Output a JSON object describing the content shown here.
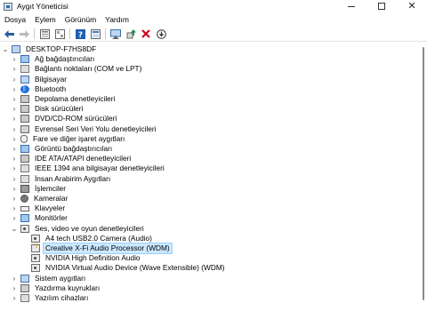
{
  "window": {
    "title": "Aygıt Yöneticisi",
    "buttons": {
      "minimize": "—",
      "maximize": "□",
      "close": "✕"
    }
  },
  "menu": [
    "Dosya",
    "Eylem",
    "Görünüm",
    "Yardım"
  ],
  "toolbar": {
    "items": [
      {
        "name": "back-icon",
        "glyph": "←"
      },
      {
        "name": "forward-icon",
        "glyph": "→"
      },
      {
        "name": "properties-icon",
        "glyph": "▦"
      },
      {
        "name": "show-hidden-icon",
        "glyph": "▤"
      },
      {
        "name": "help-icon",
        "glyph": "?"
      },
      {
        "name": "view-icon",
        "glyph": "▦"
      },
      {
        "name": "scan-hardware-icon",
        "glyph": "🖥"
      },
      {
        "name": "update-driver-icon",
        "glyph": "⬆"
      },
      {
        "name": "uninstall-icon",
        "glyph": "✕"
      },
      {
        "name": "disable-icon",
        "glyph": "⬇"
      }
    ],
    "colors": {
      "uninstall": "#d0021b",
      "update": "#2e8b57",
      "help": "#1e5fb4"
    }
  },
  "tree": {
    "root": "DESKTOP-F7HS8DF",
    "categories": [
      {
        "label": "Ağ bağdaştırıcıları",
        "icon": "network-adapter-icon",
        "cls": "ic-monitor"
      },
      {
        "label": "Bağlantı noktaları (COM ve LPT)",
        "icon": "ports-icon",
        "cls": "ic-generic"
      },
      {
        "label": "Bilgisayar",
        "icon": "computer-icon",
        "cls": "ic-computer"
      },
      {
        "label": "Bluetooth",
        "icon": "bluetooth-icon",
        "cls": "ic-bt"
      },
      {
        "label": "Depolama denetleyicileri",
        "icon": "storage-controller-icon",
        "cls": "ic-disk"
      },
      {
        "label": "Disk sürücüleri",
        "icon": "disk-drive-icon",
        "cls": "ic-disk"
      },
      {
        "label": "DVD/CD-ROM sürücüleri",
        "icon": "dvd-drive-icon",
        "cls": "ic-disk"
      },
      {
        "label": "Evrensel Seri Veri Yolu denetleyicileri",
        "icon": "usb-controller-icon",
        "cls": "ic-usb"
      },
      {
        "label": "Fare ve diğer işaret aygıtları",
        "icon": "mouse-icon",
        "cls": "ic-mouse"
      },
      {
        "label": "Görüntü bağdaştırıcıları",
        "icon": "display-adapter-icon",
        "cls": "ic-monitor"
      },
      {
        "label": "IDE ATA/ATAPI denetleyicileri",
        "icon": "ide-controller-icon",
        "cls": "ic-disk"
      },
      {
        "label": "IEEE 1394 ana bilgisayar denetleyicileri",
        "icon": "ieee1394-icon",
        "cls": "ic-generic"
      },
      {
        "label": "İnsan Arabirim Aygıtları",
        "icon": "hid-icon",
        "cls": "ic-generic"
      },
      {
        "label": "İşlemciler",
        "icon": "processor-icon",
        "cls": "ic-cpu"
      },
      {
        "label": "Kameralar",
        "icon": "camera-icon",
        "cls": "ic-camera"
      },
      {
        "label": "Klavyeler",
        "icon": "keyboard-icon",
        "cls": "ic-keyboard"
      },
      {
        "label": "Monitörler",
        "icon": "monitor-icon",
        "cls": "ic-monitor"
      }
    ],
    "expanded": {
      "label": "Ses, video ve oyun denetleyicileri",
      "icon": "sound-video-game-icon",
      "children": [
        {
          "label": "A4 tech USB2.0 Camera (Audio)",
          "icon": "audio-device-icon",
          "cls": "ic-audio",
          "selected": false
        },
        {
          "label": "Creative X-Fi Audio Processor (WDM)",
          "icon": "audio-warning-icon",
          "cls": "ic-warn",
          "selected": true
        },
        {
          "label": "NVIDIA High Definition Audio",
          "icon": "audio-device-icon",
          "cls": "ic-audio",
          "selected": false
        },
        {
          "label": "NVIDIA Virtual Audio Device (Wave Extensible) (WDM)",
          "icon": "audio-device-icon",
          "cls": "ic-audio",
          "selected": false
        }
      ]
    },
    "after": [
      {
        "label": "Sistem aygıtları",
        "icon": "system-devices-icon",
        "cls": "ic-computer"
      },
      {
        "label": "Yazdırma kuyrukları",
        "icon": "print-queue-icon",
        "cls": "ic-printer"
      },
      {
        "label": "Yazılım cihazları",
        "icon": "software-device-icon",
        "cls": "ic-generic"
      }
    ],
    "selection_color": "#cce8ff"
  }
}
